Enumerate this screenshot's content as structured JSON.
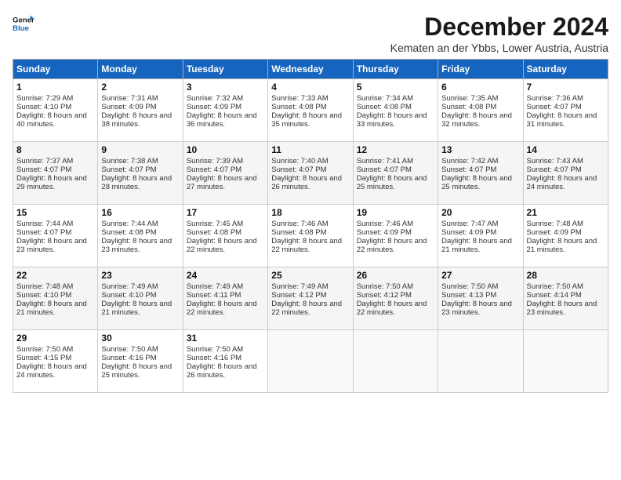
{
  "header": {
    "logo_line1": "General",
    "logo_line2": "Blue",
    "month": "December 2024",
    "location": "Kematen an der Ybbs, Lower Austria, Austria"
  },
  "days_of_week": [
    "Sunday",
    "Monday",
    "Tuesday",
    "Wednesday",
    "Thursday",
    "Friday",
    "Saturday"
  ],
  "weeks": [
    [
      {
        "day": 1,
        "sunrise": "7:29 AM",
        "sunset": "4:10 PM",
        "daylight": "8 hours and 40 minutes."
      },
      {
        "day": 2,
        "sunrise": "7:31 AM",
        "sunset": "4:09 PM",
        "daylight": "8 hours and 38 minutes."
      },
      {
        "day": 3,
        "sunrise": "7:32 AM",
        "sunset": "4:09 PM",
        "daylight": "8 hours and 36 minutes."
      },
      {
        "day": 4,
        "sunrise": "7:33 AM",
        "sunset": "4:08 PM",
        "daylight": "8 hours and 35 minutes."
      },
      {
        "day": 5,
        "sunrise": "7:34 AM",
        "sunset": "4:08 PM",
        "daylight": "8 hours and 33 minutes."
      },
      {
        "day": 6,
        "sunrise": "7:35 AM",
        "sunset": "4:08 PM",
        "daylight": "8 hours and 32 minutes."
      },
      {
        "day": 7,
        "sunrise": "7:36 AM",
        "sunset": "4:07 PM",
        "daylight": "8 hours and 31 minutes."
      }
    ],
    [
      {
        "day": 8,
        "sunrise": "7:37 AM",
        "sunset": "4:07 PM",
        "daylight": "8 hours and 29 minutes."
      },
      {
        "day": 9,
        "sunrise": "7:38 AM",
        "sunset": "4:07 PM",
        "daylight": "8 hours and 28 minutes."
      },
      {
        "day": 10,
        "sunrise": "7:39 AM",
        "sunset": "4:07 PM",
        "daylight": "8 hours and 27 minutes."
      },
      {
        "day": 11,
        "sunrise": "7:40 AM",
        "sunset": "4:07 PM",
        "daylight": "8 hours and 26 minutes."
      },
      {
        "day": 12,
        "sunrise": "7:41 AM",
        "sunset": "4:07 PM",
        "daylight": "8 hours and 25 minutes."
      },
      {
        "day": 13,
        "sunrise": "7:42 AM",
        "sunset": "4:07 PM",
        "daylight": "8 hours and 25 minutes."
      },
      {
        "day": 14,
        "sunrise": "7:43 AM",
        "sunset": "4:07 PM",
        "daylight": "8 hours and 24 minutes."
      }
    ],
    [
      {
        "day": 15,
        "sunrise": "7:44 AM",
        "sunset": "4:07 PM",
        "daylight": "8 hours and 23 minutes."
      },
      {
        "day": 16,
        "sunrise": "7:44 AM",
        "sunset": "4:08 PM",
        "daylight": "8 hours and 23 minutes."
      },
      {
        "day": 17,
        "sunrise": "7:45 AM",
        "sunset": "4:08 PM",
        "daylight": "8 hours and 22 minutes."
      },
      {
        "day": 18,
        "sunrise": "7:46 AM",
        "sunset": "4:08 PM",
        "daylight": "8 hours and 22 minutes."
      },
      {
        "day": 19,
        "sunrise": "7:46 AM",
        "sunset": "4:09 PM",
        "daylight": "8 hours and 22 minutes."
      },
      {
        "day": 20,
        "sunrise": "7:47 AM",
        "sunset": "4:09 PM",
        "daylight": "8 hours and 21 minutes."
      },
      {
        "day": 21,
        "sunrise": "7:48 AM",
        "sunset": "4:09 PM",
        "daylight": "8 hours and 21 minutes."
      }
    ],
    [
      {
        "day": 22,
        "sunrise": "7:48 AM",
        "sunset": "4:10 PM",
        "daylight": "8 hours and 21 minutes."
      },
      {
        "day": 23,
        "sunrise": "7:49 AM",
        "sunset": "4:10 PM",
        "daylight": "8 hours and 21 minutes."
      },
      {
        "day": 24,
        "sunrise": "7:49 AM",
        "sunset": "4:11 PM",
        "daylight": "8 hours and 22 minutes."
      },
      {
        "day": 25,
        "sunrise": "7:49 AM",
        "sunset": "4:12 PM",
        "daylight": "8 hours and 22 minutes."
      },
      {
        "day": 26,
        "sunrise": "7:50 AM",
        "sunset": "4:12 PM",
        "daylight": "8 hours and 22 minutes."
      },
      {
        "day": 27,
        "sunrise": "7:50 AM",
        "sunset": "4:13 PM",
        "daylight": "8 hours and 23 minutes."
      },
      {
        "day": 28,
        "sunrise": "7:50 AM",
        "sunset": "4:14 PM",
        "daylight": "8 hours and 23 minutes."
      }
    ],
    [
      {
        "day": 29,
        "sunrise": "7:50 AM",
        "sunset": "4:15 PM",
        "daylight": "8 hours and 24 minutes."
      },
      {
        "day": 30,
        "sunrise": "7:50 AM",
        "sunset": "4:16 PM",
        "daylight": "8 hours and 25 minutes."
      },
      {
        "day": 31,
        "sunrise": "7:50 AM",
        "sunset": "4:16 PM",
        "daylight": "8 hours and 26 minutes."
      },
      null,
      null,
      null,
      null
    ]
  ]
}
